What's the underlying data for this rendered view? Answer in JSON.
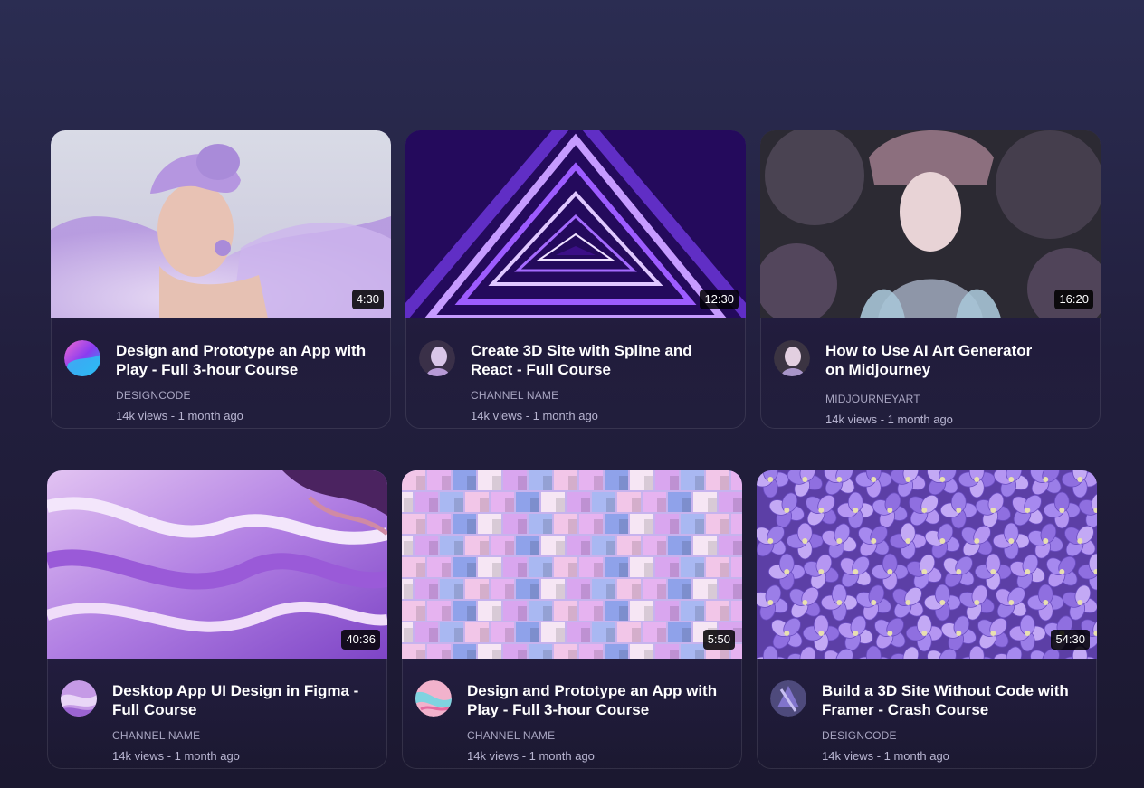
{
  "videos": [
    {
      "title": "Design and Prototype an App with Play - Full 3-hour Course",
      "channel": "DESIGNCODE",
      "meta": "14k views - 1 month ago",
      "duration": "4:30",
      "thumbnail": "woman-lavender-hair",
      "avatar": "designcode-logo"
    },
    {
      "title": "Create 3D Site with Spline and React - Full Course",
      "channel": "CHANNEL NAME",
      "meta": "14k views - 1 month ago",
      "duration": "12:30",
      "thumbnail": "neon-triangle-tunnel",
      "avatar": "portrait"
    },
    {
      "title": "How to Use AI Art Generator on Midjourney",
      "channel": "MIDJOURNEYART",
      "meta": "14k views - 1 month ago",
      "duration": "16:20",
      "thumbnail": "ai-portrait-flowers",
      "avatar": "portrait"
    },
    {
      "title": "Desktop App UI Design in Figma - Full Course",
      "channel": "CHANNEL NAME",
      "meta": "14k views - 1 month ago",
      "duration": "40:36",
      "thumbnail": "purple-marble",
      "avatar": "purple-abstract"
    },
    {
      "title": "Design and Prototype an App with Play - Full 3-hour Course",
      "channel": "CHANNEL NAME",
      "meta": "14k views - 1 month ago",
      "duration": "5:50",
      "thumbnail": "pastel-cubes",
      "avatar": "pink-abstract"
    },
    {
      "title": "Build a 3D Site Without Code with Framer - Crash Course",
      "channel": "DESIGNCODE",
      "meta": "14k views - 1 month ago",
      "duration": "54:30",
      "thumbnail": "purple-hydrangea",
      "avatar": "purple-abstract"
    }
  ],
  "colors": {
    "background": "#221f3e",
    "card": "#2a2450",
    "title": "#ffffff",
    "channel": "#a9a6c2"
  }
}
